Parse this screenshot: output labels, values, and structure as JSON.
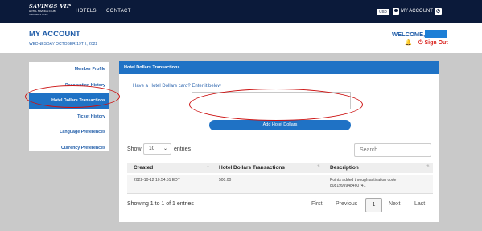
{
  "nav": {
    "logo_line1": "SAVINGS VIP",
    "logo_line2": "HOTEL SAVINGS CLUB",
    "logo_line3": "MEMBERS ONLY",
    "hotels": "HOTELS",
    "contact": "CONTACT",
    "currency": "USD",
    "my_account": "MY ACCOUNT"
  },
  "header": {
    "title": "MY ACCOUNT",
    "date": "WEDNESDAY OCTOBER 19TH, 2022",
    "welcome": "WELCOME,",
    "sign_out": "Sign Out"
  },
  "sidebar": {
    "items": [
      {
        "label": "Member Profile"
      },
      {
        "label": "Reservation History"
      },
      {
        "label": "Hotel Dollars Transactions"
      },
      {
        "label": "Ticket History"
      },
      {
        "label": "Language Preferences"
      },
      {
        "label": "Currency Preferences"
      }
    ]
  },
  "panel": {
    "title": "Hotel Dollars Transactions",
    "prompt": "Have a Hotel Dollars card? Enter it below",
    "card_value": "",
    "add_button": "Add Hotel Dollars",
    "show": "Show",
    "entries_value": "10",
    "entries": "entries",
    "search_placeholder": "Search",
    "columns": [
      "Created",
      "Hotel Dollars Transactions",
      "Description"
    ],
    "rows": [
      {
        "created": "2022-10-12 10:54:51 EDT",
        "amount": "500.00",
        "description_line1": "Points added through activation code",
        "description_line2": "8081999948460741"
      }
    ],
    "info": "Showing 1 to 1 of 1 entries",
    "pagination": {
      "first": "First",
      "previous": "Previous",
      "current": "1",
      "next": "Next",
      "last": "Last"
    }
  },
  "colors": {
    "nav_bg": "#0b1a3a",
    "accent": "#1f72c5",
    "signout": "#d9231e",
    "annotation": "#cc1111"
  }
}
